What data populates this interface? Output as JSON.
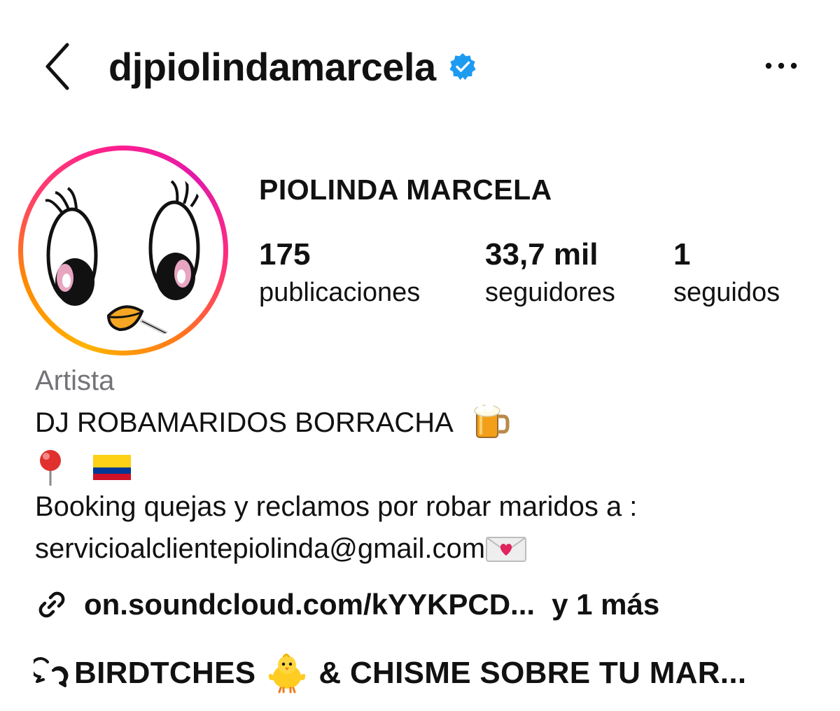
{
  "header": {
    "username": "djpiolindamarcela",
    "back_icon": "chevron-left-icon",
    "verified_icon": "verified-badge-icon",
    "more_icon": "more-horizontal-icon",
    "verified_color": "#1D9BF0"
  },
  "profile": {
    "display_name": "PIOLINDA MARCELA",
    "avatar_icon": "cartoon-bird-face-avatar",
    "stats": {
      "posts_count": "175",
      "posts_label": "publicaciones",
      "followers_count": "33,7 mil",
      "followers_label": "seguidores",
      "following_count": "1",
      "following_label": "seguidos"
    }
  },
  "bio": {
    "category": "Artista",
    "line1": "DJ ROBAMARIDOS BORRACHA",
    "line1_emoji": "beer-mug-emoji",
    "line2_emojis": [
      "round-pushpin-emoji",
      "colombia-flag-emoji"
    ],
    "line3": "Booking quejas y reclamos por robar maridos a :",
    "line4": "servicioalclientepiolinda@gmail.com",
    "line4_emoji": "love-letter-emoji"
  },
  "link": {
    "icon": "link-icon",
    "text": "on.soundcloud.com/kYYKPCD...",
    "more": "y 1 más"
  },
  "threads": {
    "icon": "threads-badge-icon",
    "text_before": "BIRDTCHES",
    "emoji": "baby-chick-emoji",
    "text_after": "& CHISME SOBRE TU MAR..."
  },
  "colors": {
    "category_gray": "#737378",
    "ring_gradient": [
      "#FFB300",
      "#FF3D6E",
      "#E21AA8"
    ]
  }
}
